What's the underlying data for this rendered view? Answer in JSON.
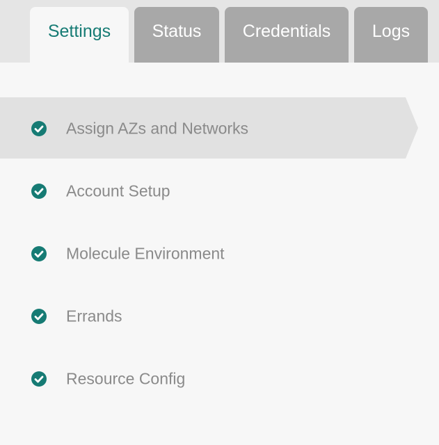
{
  "tabs": [
    {
      "label": "Settings",
      "active": true
    },
    {
      "label": "Status",
      "active": false
    },
    {
      "label": "Credentials",
      "active": false
    },
    {
      "label": "Logs",
      "active": false
    }
  ],
  "sidebar": {
    "items": [
      {
        "label": "Assign AZs and Networks",
        "status": "complete",
        "selected": true
      },
      {
        "label": "Account Setup",
        "status": "complete",
        "selected": false
      },
      {
        "label": "Molecule Environment",
        "status": "complete",
        "selected": false
      },
      {
        "label": "Errands",
        "status": "complete",
        "selected": false
      },
      {
        "label": "Resource Config",
        "status": "complete",
        "selected": false
      }
    ],
    "icon": "check-circle-icon"
  },
  "colors": {
    "accent": "#167b74",
    "tab_inactive_bg": "#a8a8a8",
    "tab_active_bg": "#f7f7f7",
    "tabbar_bg": "#e5e5e5",
    "selected_item_bg": "#e1e1e1",
    "label_text": "#8a8a8a"
  }
}
